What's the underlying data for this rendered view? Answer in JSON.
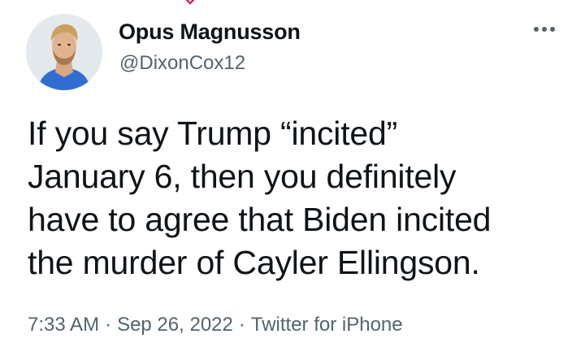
{
  "tweet": {
    "author": {
      "display_name": "Opus Magnusson",
      "handle": "@DixonCox12",
      "avatar_icon": "profile-photo"
    },
    "more_icon": "more-options-icon",
    "text": "If you say Trump  “incited”\nJanuary 6, then you definitely\nhave to agree that Biden incited\nthe murder of Cayler Ellingson.",
    "meta": {
      "time": "7:33 AM",
      "separator": "·",
      "date": "Sep 26, 2022",
      "source": "Twitter for iPhone"
    }
  },
  "colors": {
    "text_primary": "#0f1419",
    "text_secondary": "#536471",
    "background": "#ffffff",
    "top_glyph": "#e0245e"
  }
}
